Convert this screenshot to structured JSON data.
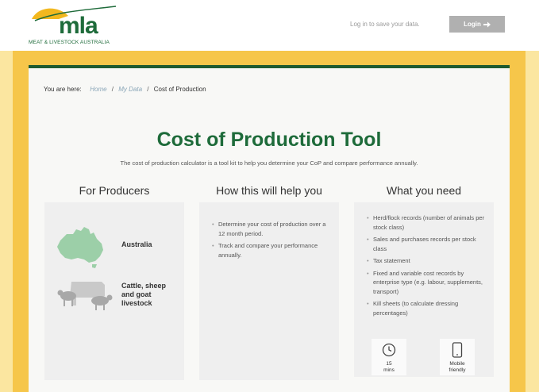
{
  "header": {
    "logo_text": "mla",
    "logo_subtitle": "MEAT & LIVESTOCK AUSTRALIA",
    "login_prompt": "Log in to save your data.",
    "login_label": "Login"
  },
  "breadcrumb": {
    "prefix": "You are here:",
    "home": "Home",
    "my_data": "My Data",
    "current": "Cost of Production"
  },
  "page": {
    "title": "Cost of Production Tool",
    "subtitle": "The cost of production calculator is a tool kit to help you determine your CoP and compare performance annually."
  },
  "columns": {
    "producers": {
      "heading": "For Producers",
      "region_label": "Australia",
      "livestock_label_1": "Cattle, sheep",
      "livestock_label_2": "and goat",
      "livestock_label_3": "livestock"
    },
    "help": {
      "heading": "How this will help you",
      "items": [
        "Determine your cost of production over a 12 month period.",
        "Track and compare your performance annually."
      ]
    },
    "need": {
      "heading": "What you need",
      "items": [
        "Herd/flock records (number of animals per stock class)",
        "Sales and purchases records per stock class",
        "Tax statement",
        "Fixed and variable cost records by enterprise type (e.g. labour, supplements, transport)",
        "Kill sheets (to calculate dressing percentages)"
      ],
      "time_line1": "15",
      "time_line2": "mins",
      "mobile_line1": "Mobile",
      "mobile_line2": "friendly"
    }
  },
  "colors": {
    "brand_green": "#1e6b3a",
    "frame_yellow": "#f6c64a",
    "logo_yellow": "#f2b81f"
  }
}
